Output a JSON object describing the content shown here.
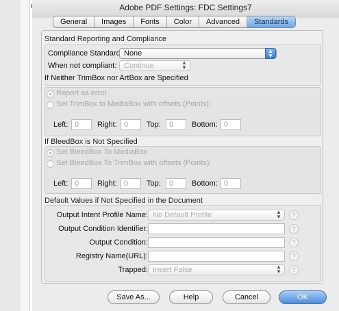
{
  "window": {
    "title": "Adobe PDF Settings: FDC Settings7"
  },
  "tabs": [
    "General",
    "Images",
    "Fonts",
    "Color",
    "Advanced",
    "Standards"
  ],
  "reporting": {
    "section_label": "Standard Reporting and Compliance",
    "compliance_label": "Compliance Standard:",
    "compliance_value": "None",
    "notcompliant_label": "When not compliant:",
    "notcompliant_value": "Continue"
  },
  "trimbox": {
    "section_label": "If Neither TrimBox nor ArtBox are Specified",
    "option1": "Report as error",
    "option2": "Set TrimBox to MediaBox with offsets (Points):",
    "left_label": "Left:",
    "left_value": "0",
    "right_label": "Right:",
    "right_value": "0",
    "top_label": "Top:",
    "top_value": "0",
    "bottom_label": "Bottom:",
    "bottom_value": "0"
  },
  "bleedbox": {
    "section_label": "If BleedBox is Not Specified",
    "option1": "Set BleedBox To MediaBox",
    "option2": "Set BleedBox To TrimBox with offsets (Points):",
    "left_label": "Left:",
    "left_value": "0",
    "right_label": "Right:",
    "right_value": "0",
    "top_label": "Top:",
    "top_value": "0",
    "bottom_label": "Bottom:",
    "bottom_value": "0"
  },
  "defaults": {
    "section_label": "Default Values if Not Specified in the Document",
    "oip_label": "Output Intent Profile Name:",
    "oip_value": "No Default Profile",
    "oci_label": "Output Condition Identifier:",
    "oci_value": "",
    "oc_label": "Output Condition:",
    "oc_value": "",
    "registry_label": "Registry Name(URL):",
    "registry_value": "",
    "trapped_label": "Trapped:",
    "trapped_value": "Insert False",
    "help_glyph": "?"
  },
  "buttons": {
    "save_as": "Save As...",
    "help": "Help",
    "cancel": "Cancel",
    "ok": "OK"
  },
  "colors": {
    "accent": "#4a8fde",
    "tab_active": "#6ea7e6"
  }
}
